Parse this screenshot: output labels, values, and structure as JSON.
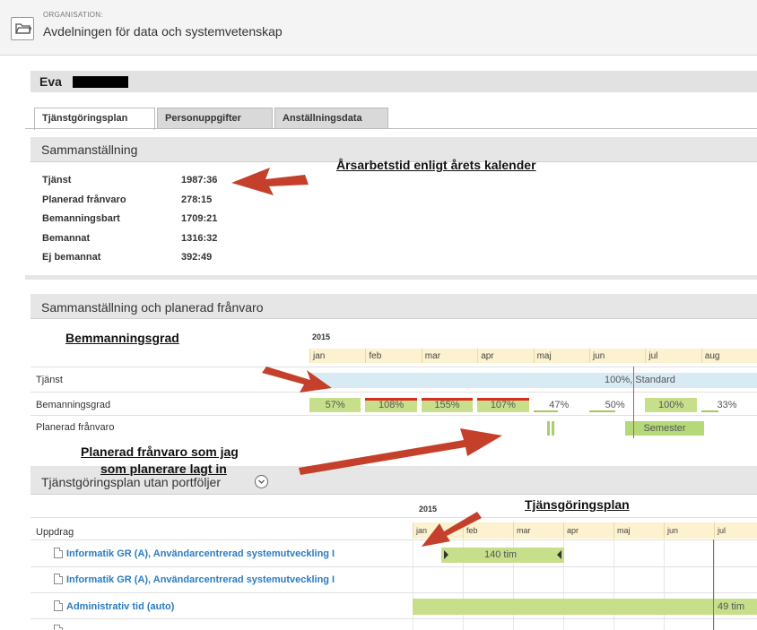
{
  "org": {
    "caption": "ORGANISATION:",
    "name": "Avdelningen för data och systemvetenskap",
    "icon": "folder-icon"
  },
  "person": {
    "name": "Eva"
  },
  "tabs": [
    {
      "label": "Tjänstgöringsplan",
      "active": true
    },
    {
      "label": "Personuppgifter",
      "active": false
    },
    {
      "label": "Anställningsdata",
      "active": false
    }
  ],
  "summary": {
    "title": "Sammanställning",
    "rows": [
      {
        "label": "Tjänst",
        "value": "1987:36"
      },
      {
        "label": "Planerad frånvaro",
        "value": "278:15"
      },
      {
        "label": "Bemanningsbart",
        "value": "1709:21"
      },
      {
        "label": "Bemannat",
        "value": "1316:32"
      },
      {
        "label": "Ej bemannat",
        "value": "392:49"
      }
    ]
  },
  "planned": {
    "title": "Sammanställning och planerad frånvaro",
    "year": "2015",
    "months": [
      "jan",
      "feb",
      "mar",
      "apr",
      "maj",
      "jun",
      "jul",
      "aug"
    ],
    "rows": {
      "tjanst": "Tjänst",
      "bemanningsgrad": "Bemanningsgrad",
      "franvaro": "Planerad frånvaro"
    },
    "tjanst_text": "100%, Standard",
    "staffing": [
      "57%",
      "108%",
      "155%",
      "107%",
      "47%",
      "50%",
      "100%",
      "33%"
    ],
    "staffing_level": [
      0.57,
      1.08,
      1.55,
      1.07,
      0.47,
      0.5,
      1.0,
      0.33
    ],
    "absence_label": "Semester"
  },
  "plan": {
    "title": "Tjänstgöringsplan utan portföljer",
    "year": "2015",
    "months": [
      "jan",
      "feb",
      "mar",
      "apr",
      "maj",
      "jun",
      "jul"
    ],
    "column_header": "Uppdrag",
    "rows": [
      {
        "label": "Informatik GR (A), Användarcentrerad systemutveckling I",
        "bar_text": "140 tim"
      },
      {
        "label": "Informatik GR (A), Användarcentrerad systemutveckling I",
        "bar_text": ""
      },
      {
        "label": "Administrativ tid (auto)",
        "bar_text": "49 tim"
      }
    ]
  },
  "annotations": {
    "arsarbetstid": "Årsarbetstid enligt årets kalender",
    "bemmanningsgrad": "Bemmanningsgrad",
    "franvaro_line1": "Planerad frånvaro som jag",
    "franvaro_line2": "som planerare lagt in",
    "tjansgoringsplan": "Tjänsgöringsplan"
  },
  "colors": {
    "accent_link": "#2b7cc1",
    "bar_green": "#c7df8a",
    "overstaff_red": "#d62d20",
    "month_header": "#fcf2cf",
    "arrow": "#c5402a"
  }
}
